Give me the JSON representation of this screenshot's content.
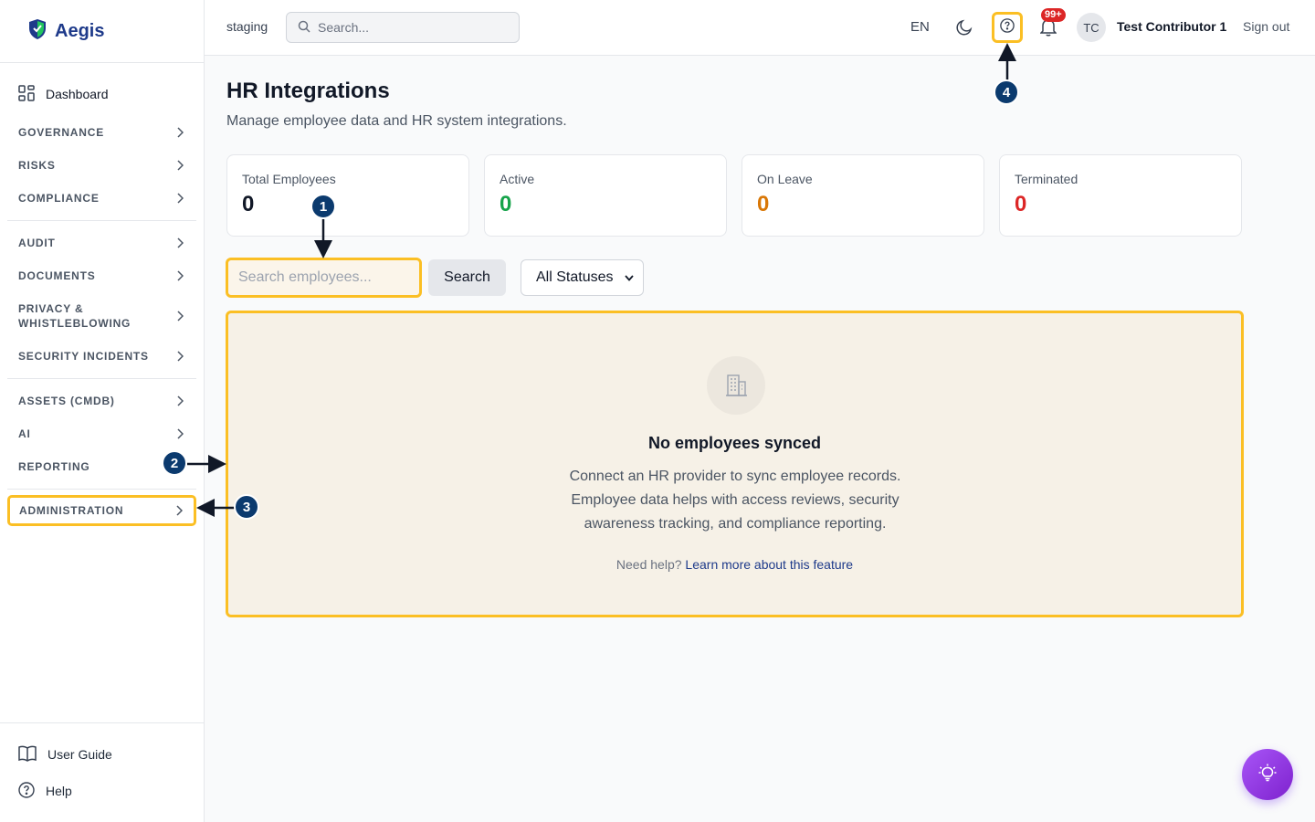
{
  "brand": {
    "name": "Aegis"
  },
  "sidebar": {
    "dashboard": "Dashboard",
    "groups": [
      [
        "GOVERNANCE",
        "RISKS",
        "COMPLIANCE"
      ],
      [
        "AUDIT",
        "DOCUMENTS",
        "PRIVACY &\nWHISTLEBLOWING",
        "SECURITY INCIDENTS"
      ],
      [
        "ASSETS (CMDB)",
        "AI",
        "REPORTING"
      ],
      [
        "ADMINISTRATION"
      ]
    ],
    "footer": {
      "guide": "User Guide",
      "help": "Help"
    }
  },
  "topbar": {
    "env": "staging",
    "search_placeholder": "Search...",
    "lang": "EN",
    "notif_badge": "99+",
    "avatar": "TC",
    "user_name": "Test Contributor 1",
    "sign_out": "Sign out"
  },
  "main": {
    "title": "HR Integrations",
    "subtitle": "Manage employee data and HR system integrations.",
    "stats": [
      {
        "label": "Total Employees",
        "value": "0",
        "color": "#111827"
      },
      {
        "label": "Active",
        "value": "0",
        "color": "#16a34a"
      },
      {
        "label": "On Leave",
        "value": "0",
        "color": "#d97706"
      },
      {
        "label": "Terminated",
        "value": "0",
        "color": "#dc2626"
      }
    ],
    "search_placeholder": "Search employees...",
    "search_button": "Search",
    "status_filter": "All Statuses",
    "empty": {
      "title": "No employees synced",
      "description": "Connect an HR provider to sync employee records. Employee data helps with access reviews, security awareness tracking, and compliance reporting.",
      "help_prefix": "Need help?",
      "help_link": "Learn more about this feature"
    }
  },
  "annotations": [
    "1",
    "2",
    "3",
    "4"
  ],
  "colors": {
    "highlight": "#fbbf24",
    "marker": "#0b3a6e",
    "brand": "#1e3a8a"
  }
}
